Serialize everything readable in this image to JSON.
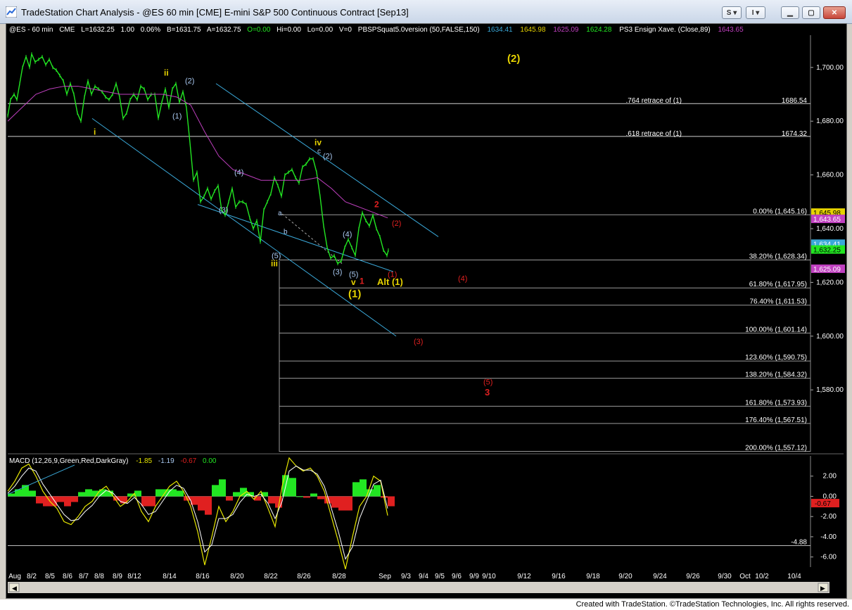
{
  "window": {
    "title": "TradeStation Chart Analysis - @ES 60 min [CME] E-mini S&P 500 Continuous Contract [Sep13]",
    "s_button": "S",
    "i_button": "I"
  },
  "header": {
    "symbol": "@ES - 60 min",
    "exchange": "CME",
    "last": "L=1632.25",
    "change": "1.00",
    "pct": "0.06%",
    "bid": "B=1631.75",
    "ask": "A=1632.75",
    "open": "O=0.00",
    "hi": "Hi=0.00",
    "lo": "Lo=0.00",
    "vol": "V=0",
    "indicator": "PBSPSquat5.0version (50,FALSE,150)",
    "ind_values": [
      "1634.41",
      "1645.98",
      "1625.09",
      "1624.28"
    ],
    "ensign": "PS3 Ensign Xave. (Close,89)",
    "ensign_value": "1643.65"
  },
  "colors": {
    "price": "#22e622",
    "ma": "#c040c0",
    "channel": "#3aa8d8",
    "wave_yellow": "#e6d200",
    "wave_blue": "#a8c8f0",
    "wave_red": "#e02020",
    "fib_line": "#9a9a9a",
    "macd_line": "#e6e600",
    "signal_line": "#ffffff",
    "hist_pos": "#22e622",
    "hist_neg": "#e02020"
  },
  "chart_data": [
    {
      "type": "line",
      "title": "",
      "ylim": [
        1557,
        1712
      ],
      "y_ticks": [
        1700,
        1680,
        1660,
        1640,
        1620,
        1600,
        1580
      ],
      "y_tick_labels": [
        "1,700.00",
        "1,680.00",
        "1,660.00",
        "1,640.00",
        "1,620.00",
        "1,600.00",
        "1,580.00"
      ],
      "x_tick_labels": [
        "Aug",
        "8/2",
        "8/5",
        "8/6",
        "8/7",
        "8/8",
        "8/9",
        "8/12",
        "8/14",
        "8/16",
        "8/20",
        "8/22",
        "8/26",
        "8/28",
        "Sep",
        "9/3",
        "9/4",
        "9/5",
        "9/6",
        "9/9",
        "9/10",
        "9/12",
        "9/16",
        "9/18",
        "9/20",
        "9/24",
        "9/26",
        "9/30",
        "Oct",
        "10/2",
        "10/4"
      ],
      "series": [
        {
          "x": [
            0,
            4,
            9,
            13,
            17,
            21,
            26,
            31,
            34,
            39,
            44,
            49,
            54,
            59,
            64,
            69,
            74,
            79,
            84,
            89,
            94,
            99,
            104,
            109,
            114,
            119,
            124,
            129,
            134,
            139,
            144,
            149,
            154,
            159,
            164,
            169,
            174,
            179,
            184,
            189,
            194,
            199,
            204,
            209,
            214,
            219,
            224,
            229,
            234,
            239,
            244,
            249,
            254,
            259,
            264,
            269,
            274,
            279,
            284,
            289,
            294,
            299,
            304,
            309,
            314,
            319,
            324,
            329,
            334,
            339,
            344,
            349,
            354,
            359,
            364,
            369,
            374,
            379,
            384,
            389,
            394,
            399,
            404,
            409,
            414,
            419,
            424,
            429,
            434,
            439,
            444,
            449,
            454,
            459,
            464,
            469,
            474,
            479,
            484,
            489,
            494,
            499,
            504,
            509,
            514,
            519,
            524,
            529,
            534,
            539,
            541
          ],
          "values": [
            1682,
            1688,
            1690,
            1688,
            1694,
            1700,
            1704,
            1700,
            1705,
            1702,
            1703,
            1704,
            1701,
            1703,
            1700,
            1699,
            1697,
            1695,
            1690,
            1694,
            1690,
            1683,
            1680,
            1689,
            1695,
            1690,
            1693,
            1692,
            1691,
            1689,
            1688,
            1690,
            1694,
            1689,
            1681,
            1683,
            1688,
            1690,
            1688,
            1693,
            1692,
            1688,
            1690,
            1690,
            1681,
            1687,
            1692,
            1685,
            1692,
            1694,
            1687,
            1691,
            1685,
            1672,
            1658,
            1661,
            1650,
            1652,
            1655,
            1651,
            1654,
            1656,
            1647,
            1645,
            1650,
            1655,
            1648,
            1650,
            1650,
            1649,
            1644,
            1640,
            1643,
            1635,
            1647,
            1650,
            1653,
            1659,
            1656,
            1652,
            1660,
            1661,
            1662,
            1659,
            1657,
            1663,
            1664,
            1666,
            1666,
            1661,
            1652,
            1641,
            1633,
            1629,
            1630,
            1627,
            1628,
            1633,
            1636,
            1633,
            1630,
            1640,
            1646,
            1643,
            1641,
            1645,
            1640,
            1637,
            1632,
            1630,
            1632
          ]
        },
        {
          "name": "PS3 Ensign Xave.",
          "x": [
            0,
            20,
            40,
            60,
            80,
            100,
            120,
            140,
            160,
            180,
            200,
            220,
            240,
            260,
            280,
            300,
            320,
            340,
            360,
            380,
            400,
            420,
            440,
            460,
            480,
            500,
            520,
            540
          ],
          "values": [
            1680,
            1685,
            1690,
            1692,
            1693,
            1693,
            1692,
            1691,
            1690,
            1690,
            1690,
            1690,
            1689,
            1686,
            1676,
            1667,
            1662,
            1660,
            1658,
            1658,
            1658,
            1658,
            1659,
            1655,
            1650,
            1648,
            1646,
            1644
          ]
        }
      ],
      "fib_levels": [
        {
          "label": "0.00% (1,645.16)",
          "value": 1645.16
        },
        {
          "label": "38.20% (1,628.34)",
          "value": 1628.34
        },
        {
          "label": "61.80% (1,617.95)",
          "value": 1617.95
        },
        {
          "label": "76.40% (1,611.53)",
          "value": 1611.53
        },
        {
          "label": "100.00% (1,601.14)",
          "value": 1601.14
        },
        {
          "label": "123.60% (1,590.75)",
          "value": 1590.75
        },
        {
          "label": "138.20% (1,584.32)",
          "value": 1584.32
        },
        {
          "label": "161.80% (1,573.93)",
          "value": 1573.93
        },
        {
          "label": "176.40% (1,567.51)",
          "value": 1567.51
        },
        {
          "label": "200.00% (1,557.12)",
          "value": 1557.12
        }
      ],
      "retrace_lines": [
        {
          "label": ".764 retrace of (1)",
          "value": 1686.54,
          "value_label": "1686.54"
        },
        {
          "label": ".618 retrace of (1)",
          "value": 1674.32,
          "value_label": "1674.32"
        }
      ],
      "price_tags": [
        {
          "label": "1,645.98",
          "value": 1645.98,
          "bg": "#e6d200",
          "fg": "#000000"
        },
        {
          "label": "1,643.65",
          "value": 1643.65,
          "bg": "#c040c0",
          "fg": "#ffffff"
        },
        {
          "label": "1,634.41",
          "value": 1634.41,
          "bg": "#3aa8d8",
          "fg": "#ffffff"
        },
        {
          "label": "1,632.25",
          "value": 1632.25,
          "bg": "#22e622",
          "fg": "#000000"
        },
        {
          "label": "1,625.09",
          "value": 1625.09,
          "bg": "#c040c0",
          "fg": "#ffffff"
        }
      ],
      "wave_labels": [
        {
          "text": "(2)",
          "x": 710,
          "y": 1702,
          "color": "yellow",
          "size": 15
        },
        {
          "text": "ii",
          "x": 222,
          "y": 1697,
          "color": "yellow",
          "size": 12
        },
        {
          "text": "(2)",
          "x": 252,
          "y": 1694,
          "color": "blue",
          "size": 11
        },
        {
          "text": "(1)",
          "x": 234,
          "y": 1681,
          "color": "blue",
          "size": 11
        },
        {
          "text": "i",
          "x": 122,
          "y": 1675,
          "color": "yellow",
          "size": 12
        },
        {
          "text": "iv",
          "x": 436,
          "y": 1671,
          "color": "yellow",
          "size": 12
        },
        {
          "text": "c",
          "x": 440,
          "y": 1668,
          "color": "blue",
          "size": 10
        },
        {
          "text": "(2)",
          "x": 448,
          "y": 1666,
          "color": "blue",
          "size": 11
        },
        {
          "text": "(4)",
          "x": 322,
          "y": 1660,
          "color": "blue",
          "size": 11
        },
        {
          "text": "(3)",
          "x": 300,
          "y": 1646,
          "color": "blue",
          "size": 11
        },
        {
          "text": "a",
          "x": 384,
          "y": 1645,
          "color": "blue",
          "size": 10
        },
        {
          "text": "b",
          "x": 392,
          "y": 1638,
          "color": "blue",
          "size": 10
        },
        {
          "text": "2",
          "x": 521,
          "y": 1648,
          "color": "red",
          "size": 12
        },
        {
          "text": "(2)",
          "x": 546,
          "y": 1641,
          "color": "red",
          "size": 11
        },
        {
          "text": "(4)",
          "x": 476,
          "y": 1637,
          "color": "blue",
          "size": 11
        },
        {
          "text": "(5)",
          "x": 375,
          "y": 1629,
          "color": "blue",
          "size": 11
        },
        {
          "text": "iii",
          "x": 374,
          "y": 1626,
          "color": "yellow",
          "size": 12
        },
        {
          "text": "(3)",
          "x": 462,
          "y": 1623,
          "color": "blue",
          "size": 11
        },
        {
          "text": "(5)",
          "x": 485,
          "y": 1622,
          "color": "blue",
          "size": 11
        },
        {
          "text": "v",
          "x": 488,
          "y": 1619,
          "color": "yellow",
          "size": 12
        },
        {
          "text": "1",
          "x": 500,
          "y": 1619.5,
          "color": "red",
          "size": 12
        },
        {
          "text": "(1)",
          "x": 540,
          "y": 1622,
          "color": "red",
          "size": 11
        },
        {
          "text": "Alt (1)",
          "x": 525,
          "y": 1619,
          "color": "yellow",
          "size": 13
        },
        {
          "text": "(4)",
          "x": 640,
          "y": 1620.5,
          "color": "red",
          "size": 11
        },
        {
          "text": "(1)",
          "x": 484,
          "y": 1614.5,
          "color": "yellow",
          "size": 15
        },
        {
          "text": "(3)",
          "x": 577,
          "y": 1597,
          "color": "red",
          "size": 11
        },
        {
          "text": "(5)",
          "x": 676,
          "y": 1582,
          "color": "red",
          "size": 11
        },
        {
          "text": "3",
          "x": 678,
          "y": 1578,
          "color": "red",
          "size": 13
        }
      ],
      "channels": [
        [
          [
            120,
            1681
          ],
          [
            552,
            1600
          ]
        ],
        [
          [
            296,
            1694
          ],
          [
            612,
            1637
          ]
        ],
        [
          [
            270,
            1649
          ],
          [
            548,
            1624
          ]
        ]
      ],
      "dashed_line": [
        [
          390,
          1645.5
        ],
        [
          475,
          1627
        ]
      ],
      "vertical_line_x": 386
    },
    {
      "type": "line",
      "title": "MACD (12,26,9,Green,Red,DarkGray)",
      "header_values": [
        "-1.85",
        "-1.19",
        "-0.67",
        "0.00"
      ],
      "ylim": [
        -7,
        4
      ],
      "y_ticks": [
        2,
        0,
        -2,
        -4,
        -6
      ],
      "y_tick_labels": [
        "2.00",
        "0.00",
        "-2.00",
        "-4.00",
        "-6.00"
      ],
      "level_line": {
        "label": "-4.88",
        "value": -4.88
      },
      "value_tag": {
        "label": "-0.67",
        "value": -0.67
      },
      "trendline": [
        [
          0,
          0.2
        ],
        [
          95,
          3.1
        ]
      ],
      "series": [
        {
          "name": "MACD",
          "x": [
            0,
            10,
            20,
            30,
            40,
            50,
            60,
            70,
            80,
            90,
            100,
            110,
            120,
            130,
            140,
            150,
            160,
            170,
            180,
            190,
            200,
            210,
            220,
            230,
            240,
            250,
            260,
            270,
            280,
            290,
            300,
            310,
            320,
            330,
            340,
            350,
            360,
            370,
            380,
            390,
            400,
            410,
            420,
            430,
            440,
            450,
            460,
            470,
            480,
            490,
            500,
            510,
            520,
            530,
            540
          ],
          "values": [
            0.5,
            1.5,
            2.8,
            3.2,
            2,
            0.5,
            -0.5,
            -1.2,
            -2.5,
            -2.8,
            -2,
            -1,
            -0.5,
            0.5,
            1,
            0,
            -1,
            -0.5,
            0.3,
            -1.5,
            -2.5,
            -1,
            0,
            1,
            1.5,
            0.5,
            -1,
            -3.5,
            -6.8,
            -4,
            -1,
            -2.5,
            -1.5,
            0,
            0.5,
            -0.3,
            0.5,
            -1.2,
            -3,
            1,
            3.8,
            3,
            2.5,
            2.8,
            2,
            0.5,
            -2,
            -4.5,
            -7.2,
            -4,
            -1,
            0,
            2,
            1.5,
            -1.9
          ]
        },
        {
          "name": "Avg",
          "x": [
            0,
            10,
            20,
            30,
            40,
            50,
            60,
            70,
            80,
            90,
            100,
            110,
            120,
            130,
            140,
            150,
            160,
            170,
            180,
            190,
            200,
            210,
            220,
            230,
            240,
            250,
            260,
            270,
            280,
            290,
            300,
            310,
            320,
            330,
            340,
            350,
            360,
            370,
            380,
            390,
            400,
            410,
            420,
            430,
            440,
            450,
            460,
            470,
            480,
            490,
            500,
            510,
            520,
            530,
            540
          ],
          "values": [
            0.3,
            1,
            2,
            2.8,
            2.5,
            1.2,
            0.2,
            -0.8,
            -1.8,
            -2.4,
            -2.3,
            -1.5,
            -0.9,
            0,
            0.6,
            0.3,
            -0.5,
            -0.7,
            -0.1,
            -0.8,
            -1.8,
            -1.5,
            -0.5,
            0.5,
            1.1,
            0.8,
            -0.4,
            -2.5,
            -5.5,
            -4.8,
            -2.2,
            -2.2,
            -1.8,
            -0.6,
            0.2,
            0,
            0.2,
            -0.7,
            -2.2,
            -0.5,
            2.5,
            3,
            2.6,
            2.6,
            2.2,
            1,
            -1.2,
            -3.5,
            -6.2,
            -5,
            -2.2,
            -0.5,
            1.2,
            1.6,
            -1.2
          ]
        }
      ]
    }
  ],
  "footer": "Created with TradeStation. ©TradeStation Technologies, Inc. All rights reserved."
}
